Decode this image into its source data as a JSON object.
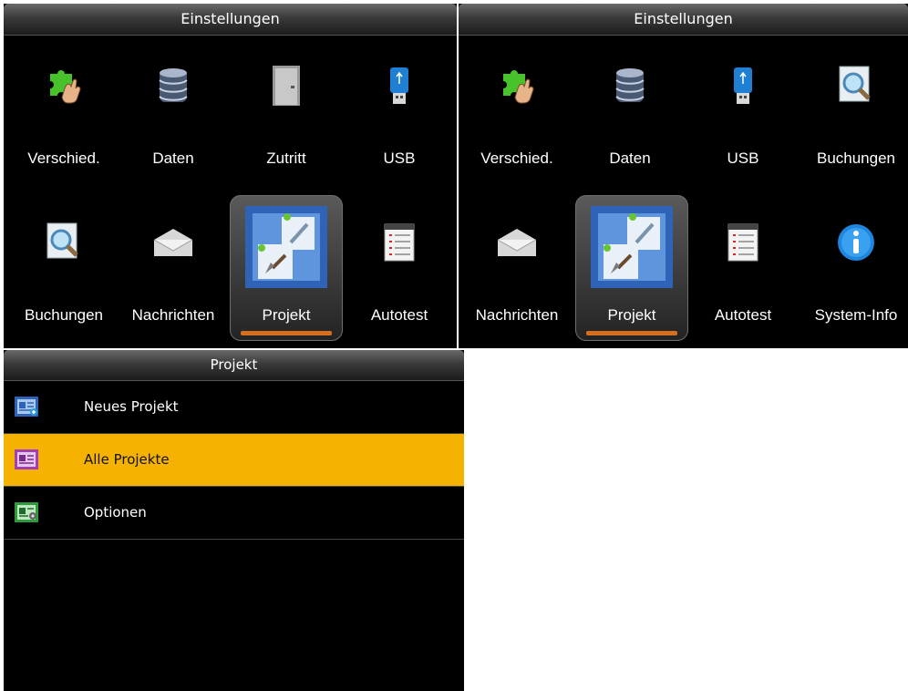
{
  "screen_left": {
    "title": "Einstellungen",
    "tiles": [
      {
        "label": "Verschied.",
        "icon": "puzzle-hand-icon"
      },
      {
        "label": "Daten",
        "icon": "database-icon"
      },
      {
        "label": "Zutritt",
        "icon": "door-icon"
      },
      {
        "label": "USB",
        "icon": "usb-stick-icon"
      },
      {
        "label": "Buchungen",
        "icon": "magnifier-icon"
      },
      {
        "label": "Nachrichten",
        "icon": "envelope-icon"
      },
      {
        "label": "Projekt",
        "icon": "project-tools-icon",
        "selected": true
      },
      {
        "label": "Autotest",
        "icon": "checklist-icon"
      }
    ]
  },
  "screen_right": {
    "title": "Einstellungen",
    "tiles": [
      {
        "label": "Verschied.",
        "icon": "puzzle-hand-icon"
      },
      {
        "label": "Daten",
        "icon": "database-icon"
      },
      {
        "label": "USB",
        "icon": "usb-stick-icon"
      },
      {
        "label": "Buchungen",
        "icon": "magnifier-icon"
      },
      {
        "label": "Nachrichten",
        "icon": "envelope-icon"
      },
      {
        "label": "Projekt",
        "icon": "project-tools-icon",
        "selected": true
      },
      {
        "label": "Autotest",
        "icon": "checklist-icon"
      },
      {
        "label": "System-Info",
        "icon": "info-icon"
      }
    ]
  },
  "screen_project": {
    "title": "Projekt",
    "items": [
      {
        "label": "Neues Projekt",
        "icon": "new-project-icon"
      },
      {
        "label": "Alle Projekte",
        "icon": "all-projects-icon",
        "active": true
      },
      {
        "label": "Optionen",
        "icon": "project-options-icon"
      }
    ]
  },
  "colors": {
    "highlight": "#f5b200",
    "selection_bar": "#d36f1f",
    "background": "#000000"
  }
}
